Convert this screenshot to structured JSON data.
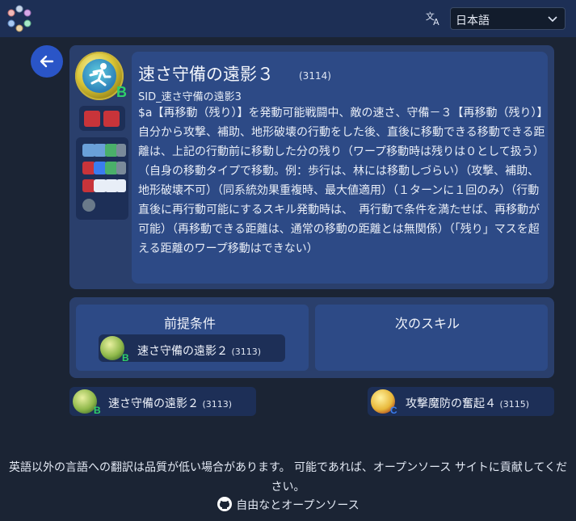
{
  "header": {
    "language": "日本語",
    "translate_icon": "translate-icon",
    "logo_icon": "orbs-logo-icon"
  },
  "skill": {
    "name": "速さ守備の遠影３",
    "id": "(3114)",
    "sid": "SID_速さ守備の遠影3",
    "slot": "B",
    "description": "$a【再移動（残り）】を発動可能戦闘中、敵の速さ、守備－３【再移動（残り）】自分から攻撃、補助、地形破壊の行動をした後、直後に移動できる移動できる距離は、上記の行動前に移動した分の残り（ワープ移動時は残りは０として扱う）（自身の移動タイプで移動。例：歩行は、林には移動しづらい）（攻撃、補助、地形破壊不可）（同系統効果重複時、最大値適用）（１ターンに１回のみ）（行動直後に再行動可能にするスキル発動時は、　再行動で条件を満たせば、再移動が可能）（再移動できる距離は、通常の移動の距離とは無関係）（「残り」マスを超える距離のワープ移動はできない）"
  },
  "relations": {
    "prereq_title": "前提条件",
    "next_title": "次のスキル",
    "prereq": {
      "name": "速さ守備の遠影２",
      "id": "(3113)",
      "slot": "B"
    }
  },
  "nav": {
    "prev": {
      "name": "速さ守備の遠影２",
      "id": "(3113)",
      "slot": "B"
    },
    "next": {
      "name": "攻撃魔防の奮起４",
      "id": "(3115)",
      "slot": "C"
    }
  },
  "footer": {
    "note": "英語以外の言語への翻訳は品質が低い場合があります。 可能であれば、オープンソース サイトに貢献してください。",
    "link": "自由なとオープンソース"
  },
  "colors": {
    "accent": "#2a55c7",
    "card": "#2a3f6c",
    "panel": "#2d4a86",
    "slot_b": "#2fd06a",
    "slot_c": "#3a7cf0"
  }
}
